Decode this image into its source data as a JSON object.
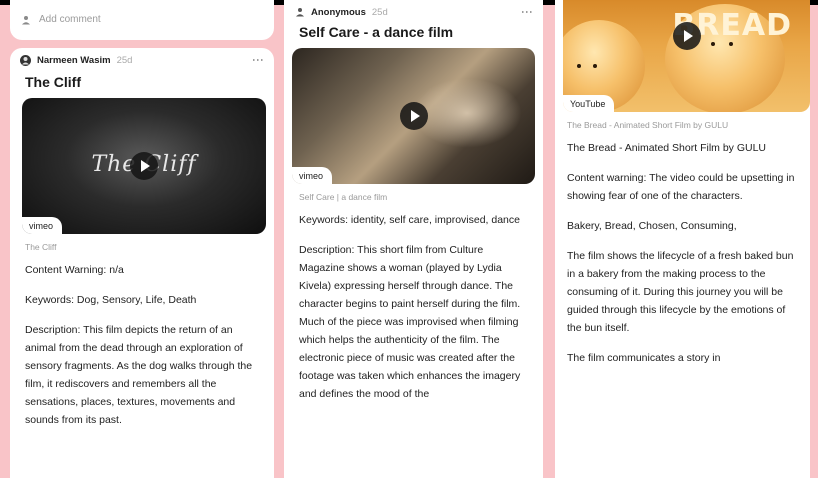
{
  "col1": {
    "comment": {
      "placeholder": "Add comment"
    },
    "card": {
      "author": "Narmeen Wasim",
      "age": "25d",
      "title": "The Cliff",
      "thumb_text": "The Cliff",
      "provider": "vimeo",
      "sub": "The Cliff",
      "paragraphs": [
        "Content Warning: n/a",
        "Keywords: Dog, Sensory, Life, Death",
        "Description: This film depicts the return of an animal from the dead through an exploration of sensory fragments. As the dog walks through the film, it rediscovers and remembers all the sensations, places, textures, movements and sounds from its past."
      ]
    }
  },
  "col2": {
    "card": {
      "author": "Anonymous",
      "age": "25d",
      "title": "Self Care - a dance film",
      "provider": "vimeo",
      "sub": "Self Care | a dance film",
      "paragraphs": [
        "Keywords: identity, self care, improvised, dance",
        "Description: This short film from Culture Magazine shows a woman (played by Lydia Kivela) expressing herself through dance. The character begins to paint herself during the film. Much of the piece was improvised when filming which helps the authenticity of the film. The electronic piece of music was created after the footage was taken which enhances the imagery and defines the mood of the"
      ]
    }
  },
  "col3": {
    "card": {
      "thumb_text": "BREAD",
      "provider": "YouTube",
      "sub": "The Bread - Animated Short Film by GULU",
      "paragraphs": [
        "The Bread - Animated Short Film by GULU",
        "Content warning: The video could be upsetting in showing fear of one of the characters.",
        "Bakery, Bread, Chosen, Consuming,",
        "The film shows the lifecycle of a fresh baked bun in a bakery from the making process to the consuming of it. During this journey you will be guided through this lifecycle by the emotions of the bun itself.",
        "The film communicates a story in"
      ]
    }
  },
  "icons": {
    "comment": "comment-icon",
    "avatar": "avatar-icon",
    "more": "more-vertical-icon",
    "play": "play-icon"
  }
}
